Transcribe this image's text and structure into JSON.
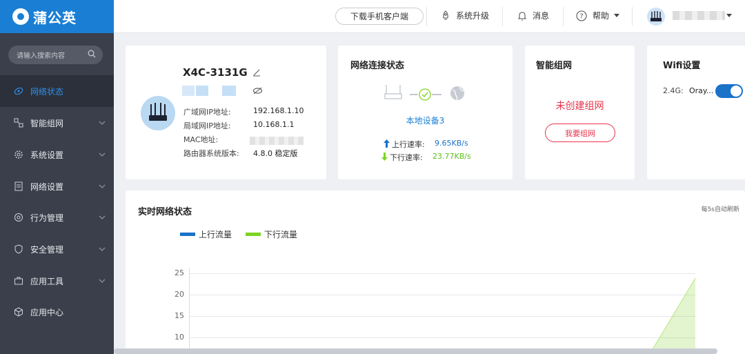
{
  "app": {
    "name": "蒲公英"
  },
  "sidebar": {
    "search_placeholder": "请输入搜索内容",
    "items": [
      {
        "label": "网络状态",
        "active": true
      },
      {
        "label": "智能组网"
      },
      {
        "label": "系统设置"
      },
      {
        "label": "网络设置"
      },
      {
        "label": "行为管理"
      },
      {
        "label": "安全管理"
      },
      {
        "label": "应用工具"
      },
      {
        "label": "应用中心"
      }
    ]
  },
  "topbar": {
    "download": "下载手机客户端",
    "upgrade": "系统升级",
    "messages": "消息",
    "help": "帮助"
  },
  "device": {
    "model": "X4C-3131G",
    "labels": {
      "wan": "广域网IP地址:",
      "lan": "局域网IP地址:",
      "mac": "MAC地址:",
      "version": "路由器系统版本:"
    },
    "wan_ip": "192.168.1.10",
    "lan_ip": "10.168.1.1",
    "version": "4.8.0 稳定版"
  },
  "connection": {
    "title": "网络连接状态",
    "device": "本地设备3",
    "up_label": "上行速率:",
    "up_rate": "9.65KB/s",
    "down_label": "下行速率:",
    "down_rate": "23.77KB/s"
  },
  "mesh": {
    "title": "智能组网",
    "status": "未创建组网",
    "button": "我要组网"
  },
  "wifi": {
    "title": "Wifi设置",
    "band": "2.4G:",
    "ssid": "Oray...",
    "enabled": true
  },
  "realtime": {
    "title": "实时网络状态",
    "refresh": "每5s自动刷新",
    "legend_up": "上行流量",
    "legend_down": "下行流量"
  },
  "chart_data": {
    "type": "area",
    "title": "实时网络状态",
    "y_ticks": [
      "25",
      "20",
      "15",
      "10"
    ],
    "series": [
      {
        "name": "上行流量",
        "color": "#1a72c9"
      },
      {
        "name": "下行流量",
        "color": "#7ed321"
      }
    ]
  },
  "colors": {
    "accent": "#1a7fd4",
    "up": "#1a72c9",
    "down": "#7ed321",
    "danger": "#e8334a"
  }
}
